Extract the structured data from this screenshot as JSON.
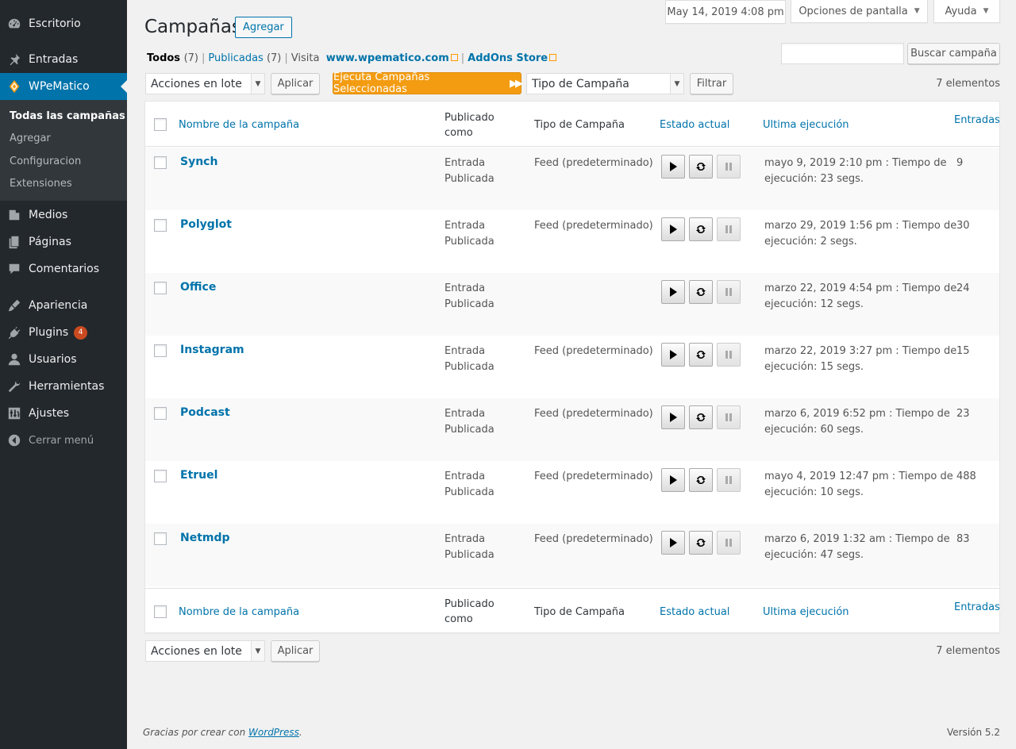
{
  "sidebar": {
    "menu": [
      {
        "label": "Escritorio",
        "icon": "dashboard-icon"
      },
      {
        "label": "Entradas",
        "icon": "pin-icon"
      },
      {
        "label": "WPeMatico",
        "icon": "wpematico-logo-icon"
      },
      {
        "label": "Medios",
        "icon": "media-icon"
      },
      {
        "label": "Páginas",
        "icon": "pages-icon"
      },
      {
        "label": "Comentarios",
        "icon": "comments-icon"
      },
      {
        "label": "Apariencia",
        "icon": "appearance-icon"
      },
      {
        "label": "Plugins",
        "icon": "plugins-icon",
        "badge": "4"
      },
      {
        "label": "Usuarios",
        "icon": "users-icon"
      },
      {
        "label": "Herramientas",
        "icon": "tools-icon"
      },
      {
        "label": "Ajustes",
        "icon": "settings-icon"
      },
      {
        "label": "Cerrar menú",
        "icon": "collapse-icon"
      }
    ],
    "submenu": [
      "Todas las campañas",
      "Agregar",
      "Configuracion",
      "Extensiones"
    ]
  },
  "screen_meta": {
    "datetime": "May 14, 2019 4:08 pm",
    "screen_options": "Opciones de pantalla",
    "help": "Ayuda"
  },
  "header": {
    "title": "Campañas",
    "add_new": "Agregar"
  },
  "views": {
    "all_label": "Todos",
    "all_count": "(7)",
    "published_label": "Publicadas",
    "published_count": "(7)",
    "visit_label": "Visita",
    "site_link": "www.wpematico.com",
    "store_link": "AddOns Store"
  },
  "search": {
    "button": "Buscar campaña",
    "placeholder": ""
  },
  "tablenav": {
    "bulk_actions": "Acciones en lote",
    "apply": "Aplicar",
    "run_selected": "Ejecuta Campañas Seleccionadas",
    "campaign_type": "Tipo de Campaña",
    "filter": "Filtrar",
    "items_count": "7 elementos"
  },
  "table": {
    "columns": {
      "name": "Nombre de la campaña",
      "published_as_1": "Publicado",
      "published_as_2": "como",
      "type": "Tipo de Campaña",
      "status": "Estado actual",
      "last_run": "Ultima ejecución",
      "posts": "Entradas"
    },
    "rows": [
      {
        "name": "Synch",
        "pub1": "Entrada",
        "pub2": "Publicada",
        "type": "Feed (predeterminado)",
        "last1": "mayo 9, 2019 2:10 pm : Tiempo de",
        "last2": "ejecución: 23 segs.",
        "posts": "9"
      },
      {
        "name": "Polyglot",
        "pub1": "Entrada",
        "pub2": "Publicada",
        "type": "Feed (predeterminado)",
        "last1": "marzo 29, 2019 1:56 pm : Tiempo de",
        "last2": "ejecución: 2 segs.",
        "posts": "30"
      },
      {
        "name": "Office",
        "pub1": "Entrada",
        "pub2": "Publicada",
        "type": "",
        "last1": "marzo 22, 2019 4:54 pm : Tiempo de",
        "last2": "ejecución: 12 segs.",
        "posts": "24"
      },
      {
        "name": "Instagram",
        "pub1": "Entrada",
        "pub2": "Publicada",
        "type": "Feed (predeterminado)",
        "last1": "marzo 22, 2019 3:27 pm : Tiempo de",
        "last2": "ejecución: 15 segs.",
        "posts": "15"
      },
      {
        "name": "Podcast",
        "pub1": "Entrada",
        "pub2": "Publicada",
        "type": "Feed (predeterminado)",
        "last1": "marzo 6, 2019 6:52 pm : Tiempo de",
        "last2": "ejecución: 60 segs.",
        "posts": "23"
      },
      {
        "name": "Etruel",
        "pub1": "Entrada",
        "pub2": "Publicada",
        "type": "Feed (predeterminado)",
        "last1": "mayo 4, 2019 12:47 pm : Tiempo de",
        "last2": "ejecución: 10 segs.",
        "posts": "488"
      },
      {
        "name": "Netmdp",
        "pub1": "Entrada",
        "pub2": "Publicada",
        "type": "Feed (predeterminado)",
        "last1": "marzo 6, 2019 1:32 am : Tiempo de",
        "last2": "ejecución: 47 segs.",
        "posts": "83"
      }
    ]
  },
  "footer": {
    "thanks_prefix": "Gracias por crear con",
    "wordpress": "WordPress",
    "period": ".",
    "version": "Versión 5.2"
  },
  "colors": {
    "sidebar_bg": "#23282d",
    "active_menu": "#0073aa",
    "link": "#0073aa",
    "orange_button": "#f39c12",
    "badge": "#ca4a1f"
  }
}
